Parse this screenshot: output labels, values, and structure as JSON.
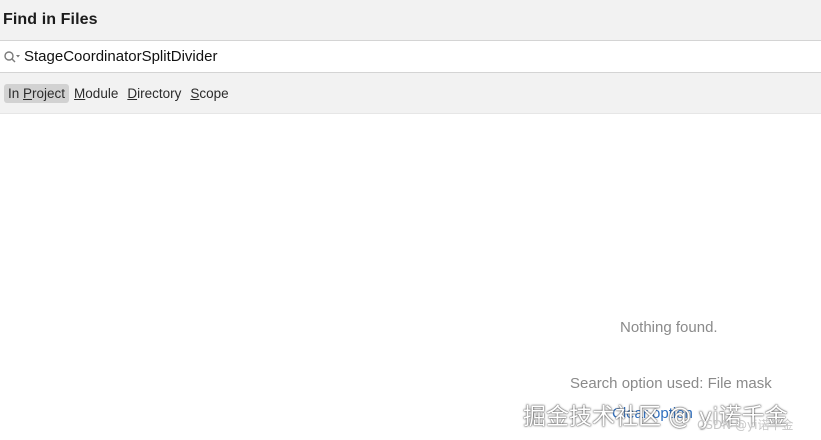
{
  "header": {
    "title": "Find in Files"
  },
  "search": {
    "value": "StageCoordinatorSplitDivider",
    "icon": "search-options-icon"
  },
  "scope_tabs": [
    {
      "label": "In Project",
      "mnemonic": "P",
      "pre": "In ",
      "post": "roject",
      "active": true
    },
    {
      "label": "Module",
      "mnemonic": "M",
      "pre": "",
      "post": "odule",
      "active": false
    },
    {
      "label": "Directory",
      "mnemonic": "D",
      "pre": "",
      "post": "irectory",
      "active": false
    },
    {
      "label": "Scope",
      "mnemonic": "S",
      "pre": "",
      "post": "cope",
      "active": false
    }
  ],
  "results": {
    "empty_message": "Nothing found.",
    "search_option_used": "Search option used: File mask",
    "clear_link": "Clear option"
  },
  "watermark": {
    "main": "掘金技术社区 @ yi诺千金",
    "sub": "CSDN @yi诺千金"
  },
  "colors": {
    "header_bg": "#f2f2f2",
    "active_tab_bg": "#d2d2d2",
    "muted_text": "#8a8a8a",
    "link": "#2f6fbf"
  }
}
